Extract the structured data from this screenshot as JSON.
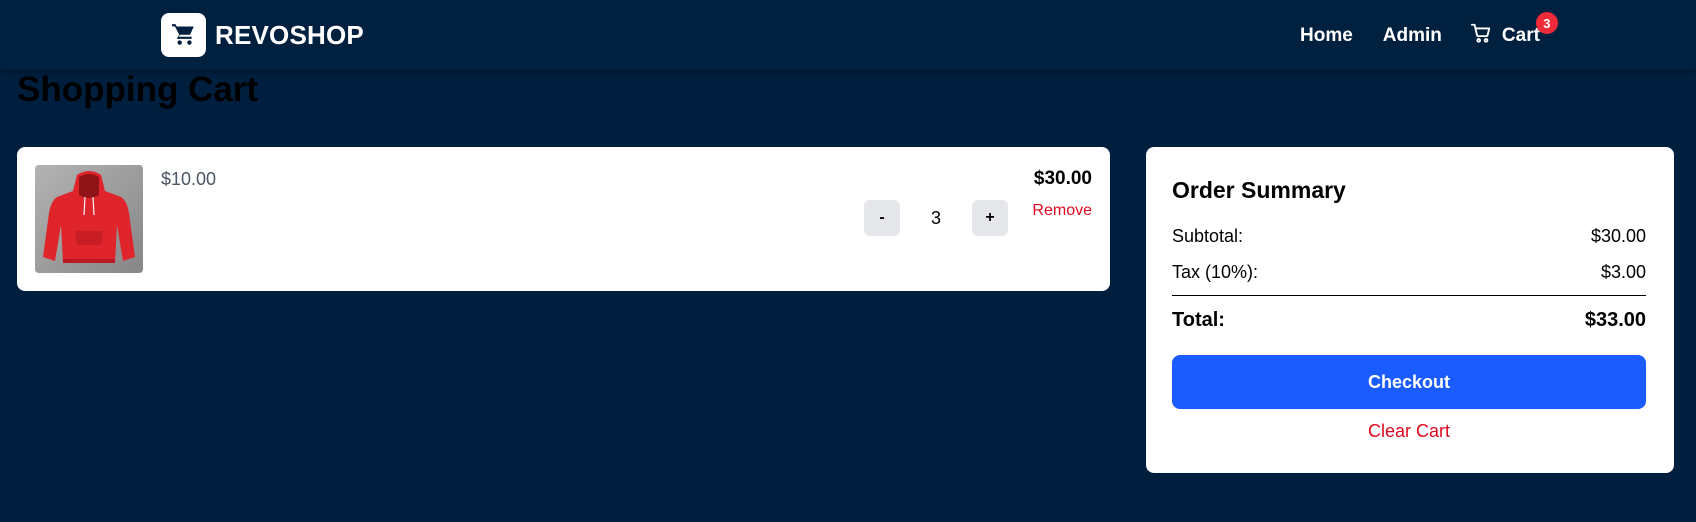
{
  "navbar": {
    "brand": {
      "logo_icon": "shopping-cart-icon",
      "name": "REVOSHOP"
    },
    "links": {
      "home": "Home",
      "admin": "Admin",
      "cart": "Cart"
    },
    "cart_icon": "cart-outline-icon",
    "cart_count": "3"
  },
  "page": {
    "title": "Shopping Cart"
  },
  "cart": {
    "items": [
      {
        "image_icon": "red-hoodie-image",
        "unit_price": "$10.00",
        "quantity": "3",
        "line_total": "$30.00",
        "decrement_label": "-",
        "increment_label": "+",
        "remove_label": "Remove"
      }
    ]
  },
  "summary": {
    "title": "Order Summary",
    "subtotal_label": "Subtotal:",
    "subtotal_value": "$30.00",
    "tax_label": "Tax (10%):",
    "tax_value": "$3.00",
    "total_label": "Total:",
    "total_value": "$33.00",
    "checkout_label": "Checkout",
    "clear_label": "Clear Cart"
  },
  "colors": {
    "background": "#001f3f",
    "primary": "#1a5cff",
    "danger": "#e0081f",
    "badge": "#ef2b3a"
  }
}
